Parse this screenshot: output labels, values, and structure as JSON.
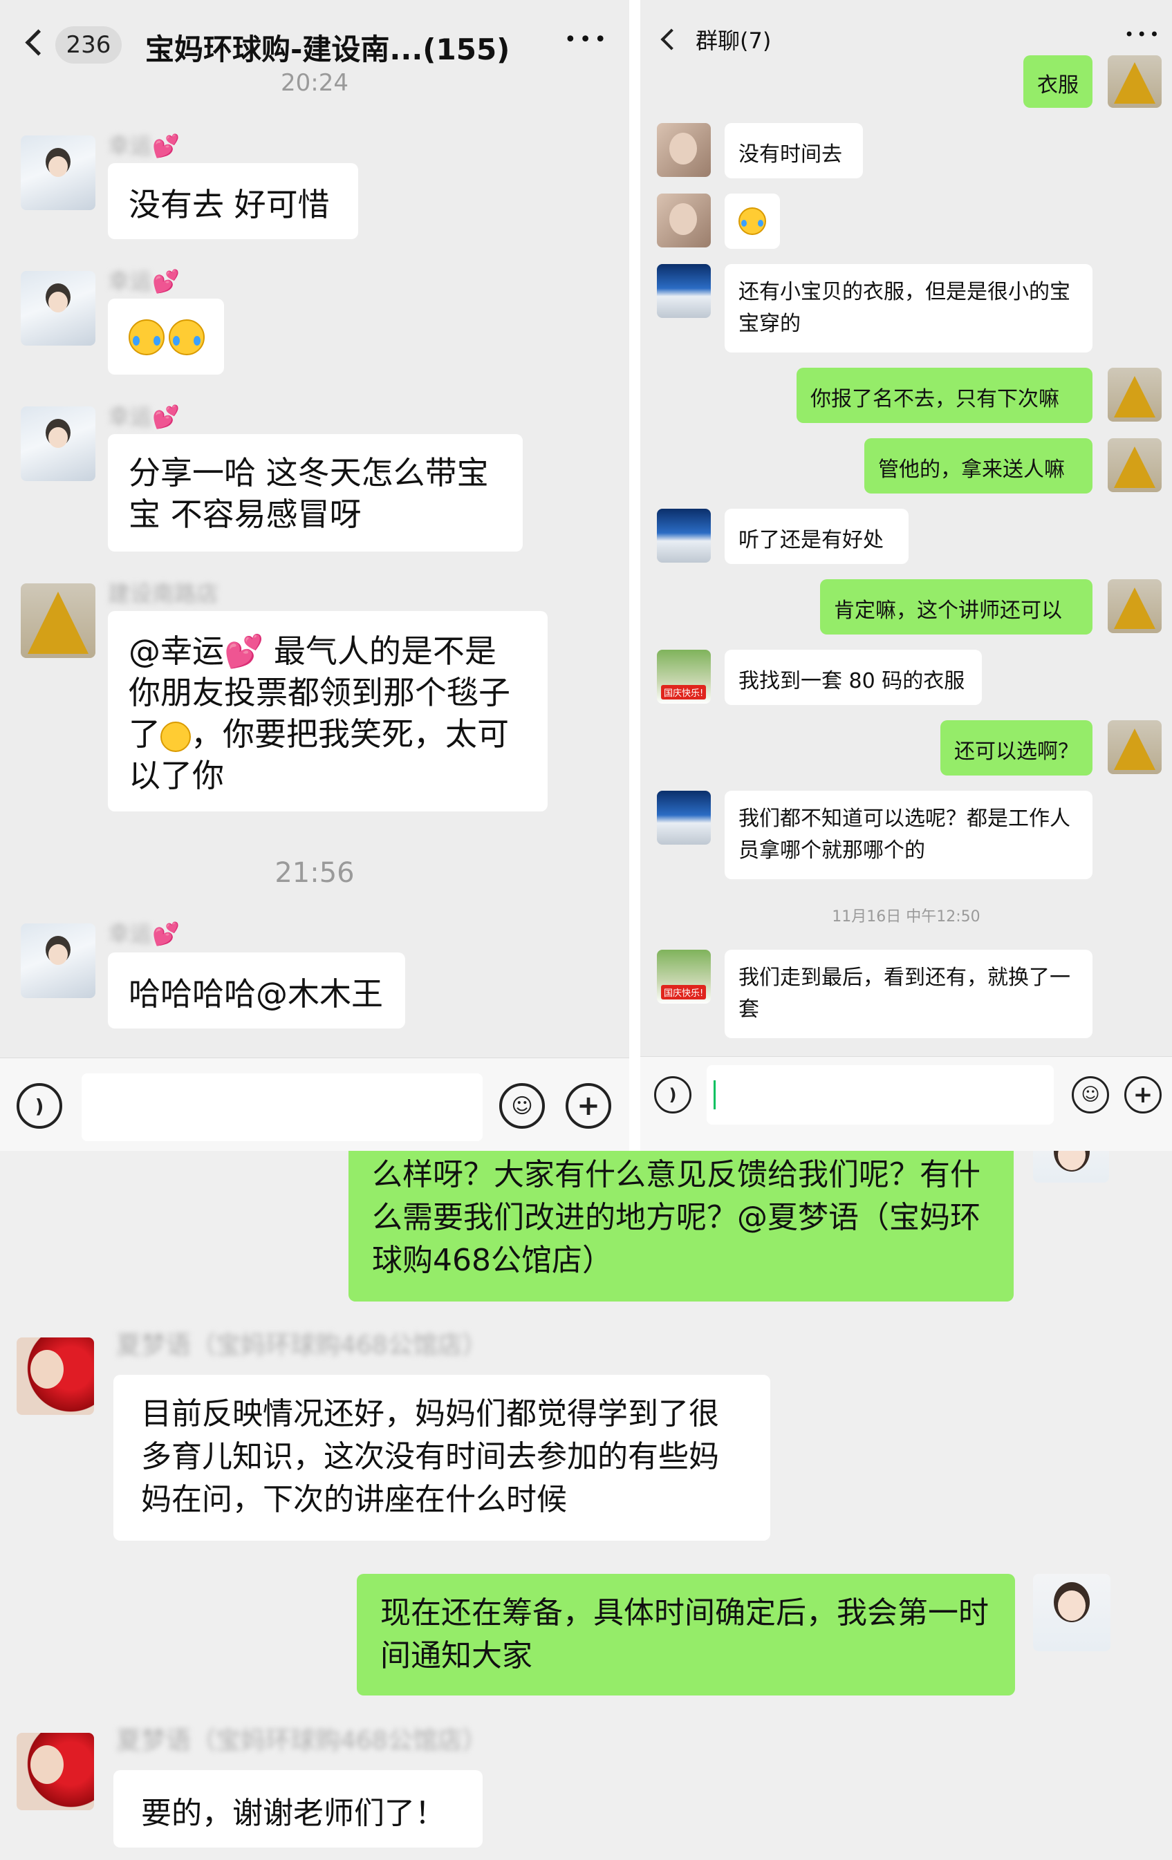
{
  "left_panel": {
    "unread_count": "236",
    "chat_title": "宝妈环球购-建设南...(155)",
    "more_icon": "•••",
    "time_top": "20:24",
    "messages": [
      {
        "sender": "幸运",
        "text": "没有去  好可惜"
      },
      {
        "sender": "幸运",
        "text": ""
      },
      {
        "sender": "幸运",
        "text": "分享一哈  这冬天怎么带宝宝  不容易感冒呀"
      },
      {
        "sender": "建设南路店",
        "text_a": "@幸运",
        "text_b": " 最气人的是不是你朋友投票都领到那个毯子了",
        "text_c": "，你要把我笑死，太可以了你"
      },
      {
        "sender": "幸运",
        "text": "哈哈哈哈@木木王"
      }
    ],
    "time_mid": "21:56"
  },
  "right_panel": {
    "chat_title": "群聊(7)",
    "more_icon": "•••",
    "messages": [
      {
        "side": "out",
        "text": "衣服"
      },
      {
        "side": "in",
        "text": "没有时间去"
      },
      {
        "side": "in",
        "text": ""
      },
      {
        "side": "in",
        "text": "还有小宝贝的衣服，但是是很小的宝宝穿的"
      },
      {
        "side": "out",
        "text": "你报了名不去，只有下次嘛"
      },
      {
        "side": "out",
        "text": "管他的，拿来送人嘛"
      },
      {
        "side": "in",
        "text": "听了还是有好处"
      },
      {
        "side": "out",
        "text": "肯定嘛，这个讲师还可以"
      },
      {
        "side": "in",
        "text": "我找到一套 80 码的衣服"
      },
      {
        "side": "out",
        "text": "还可以选啊？"
      },
      {
        "side": "in",
        "text": "我们都不知道可以选呢？都是工作人员拿哪个就那哪个的"
      },
      {
        "side": "in",
        "text": "我们走到最后，看到还有，就换了一套"
      }
    ],
    "timestamp": "11月16日 中午12:50",
    "poster_tag": "国庆快乐!"
  },
  "bottom_panel": {
    "messages": [
      {
        "side": "out",
        "text": "么样呀？大家有什么意见反馈给我们呢？有什么需要我们改进的地方呢？@夏梦语（宝妈环球购468公馆店）"
      },
      {
        "side": "in",
        "sender": "夏梦语（宝妈环球购468公馆店）",
        "text": "目前反映情况还好，妈妈们都觉得学到了很多育儿知识，这次没有时间去参加的有些妈妈在问，下次的讲座在什么时候"
      },
      {
        "side": "out",
        "text": "现在还在筹备，具体时间确定后，我会第一时间通知大家"
      },
      {
        "side": "in",
        "sender": "夏梦语（宝妈环球购468公馆店）",
        "text": "要的，谢谢老师们了！"
      }
    ]
  },
  "colors": {
    "chat_bg": "#ededed",
    "outgoing_bubble": "#95ec69",
    "incoming_bubble": "#ffffff",
    "caret": "#07c160",
    "heart": "#ff4fa3"
  },
  "icons": {
    "back": "chevron-left-icon",
    "voice": "voice-icon",
    "emoji": "emoji-icon",
    "plus": "plus-icon",
    "more": "more-icon"
  }
}
